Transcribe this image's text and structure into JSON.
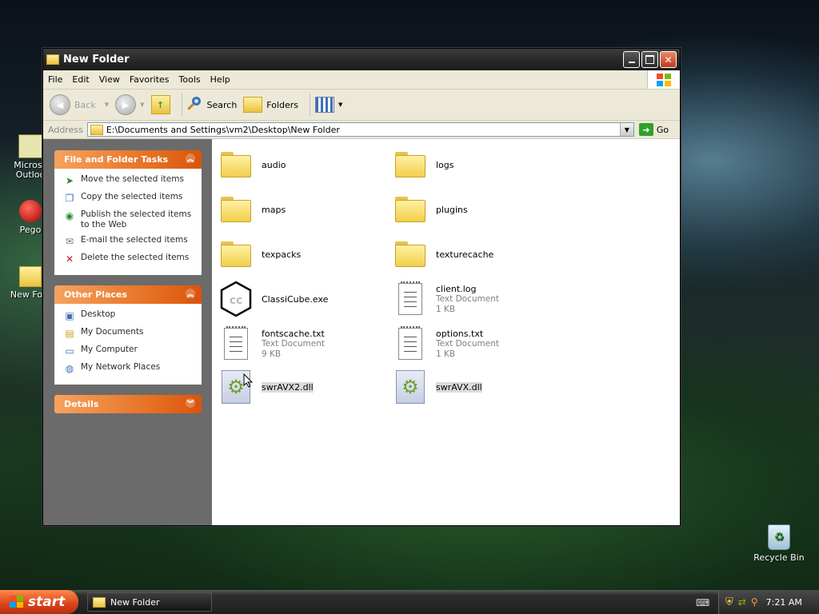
{
  "desktop": {
    "icons": [
      {
        "label": "Microsc\nOutloo"
      },
      {
        "label": "Pego"
      },
      {
        "label": "New Fold"
      },
      {
        "label": "Recycle Bin"
      }
    ]
  },
  "window": {
    "title": "New Folder",
    "menu": [
      "File",
      "Edit",
      "View",
      "Favorites",
      "Tools",
      "Help"
    ],
    "toolbar": {
      "back": "Back",
      "search": "Search",
      "folders": "Folders"
    },
    "address": {
      "label": "Address",
      "path": "E:\\Documents and Settings\\vm2\\Desktop\\New Folder",
      "go": "Go"
    }
  },
  "tasks_panel": {
    "title": "File and Folder Tasks",
    "items": [
      {
        "label": "Move the selected items",
        "icon": "move-icon"
      },
      {
        "label": "Copy the selected items",
        "icon": "copy-icon"
      },
      {
        "label": "Publish the selected items to the Web",
        "icon": "publish-web-icon"
      },
      {
        "label": "E-mail the selected items",
        "icon": "email-icon"
      },
      {
        "label": "Delete the selected items",
        "icon": "delete-icon"
      }
    ]
  },
  "places_panel": {
    "title": "Other Places",
    "items": [
      {
        "label": "Desktop",
        "icon": "desktop-icon"
      },
      {
        "label": "My Documents",
        "icon": "my-documents-icon"
      },
      {
        "label": "My Computer",
        "icon": "my-computer-icon"
      },
      {
        "label": "My Network Places",
        "icon": "network-places-icon"
      }
    ]
  },
  "details_panel": {
    "title": "Details"
  },
  "files": [
    {
      "name": "audio",
      "type": "folder"
    },
    {
      "name": "logs",
      "type": "folder"
    },
    {
      "name": "maps",
      "type": "folder"
    },
    {
      "name": "plugins",
      "type": "folder"
    },
    {
      "name": "texpacks",
      "type": "folder"
    },
    {
      "name": "texturecache",
      "type": "folder"
    },
    {
      "name": "ClassiCube.exe",
      "type": "exe"
    },
    {
      "name": "client.log",
      "type": "text",
      "kind": "Text Document",
      "size": "1 KB"
    },
    {
      "name": "fontscache.txt",
      "type": "text",
      "kind": "Text Document",
      "size": "9 KB"
    },
    {
      "name": "options.txt",
      "type": "text",
      "kind": "Text Document",
      "size": "1 KB"
    },
    {
      "name": "swrAVX2.dll",
      "type": "dll",
      "selected": true
    },
    {
      "name": "swrAVX.dll",
      "type": "dll",
      "selected": true
    }
  ],
  "taskbar": {
    "start": "start",
    "task": "New Folder",
    "clock": "7:21 AM"
  }
}
